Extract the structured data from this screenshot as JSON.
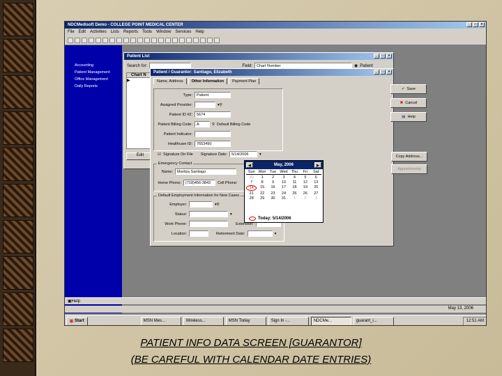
{
  "app": {
    "title": "NDCMedisoft Demo - COLLEGE POINT MEDICAL CENTER",
    "menu": [
      "File",
      "Edit",
      "Activities",
      "Lists",
      "Reports",
      "Tools",
      "Window",
      "Services",
      "Help"
    ]
  },
  "nav": {
    "items": [
      "Accounting",
      "Patient Management",
      "Office Management",
      "Daily Reports"
    ]
  },
  "patient_list": {
    "title": "Patient List",
    "search_label": "Search for:",
    "field_label": "Field:",
    "field_value": "Chart Number",
    "radio_label": "Patient",
    "col_header": "Chart N",
    "edit_label": "Edit"
  },
  "guarantor": {
    "title": "Patient / Guarantor: Santiago, Elizabeth",
    "tabs": [
      "Name, Address",
      "Other Information",
      "Payment Plan"
    ],
    "type_label": "Type:",
    "type_value": "Patient",
    "assigned_provider_label": "Assigned Provider:",
    "patient_id2_label": "Patient ID #2:",
    "patient_id2_value": "5674",
    "billing_code_label": "Patient Billing Code:",
    "billing_code_value": "A",
    "billing_code_note": "Default Billing Code",
    "indicator_label": "Patient Indicator:",
    "healthcare_id_label": "Healthcare ID:",
    "healthcare_id_value": "7653490",
    "signature_label": "Signature On File",
    "signature_date_label": "Signature Date:",
    "signature_date_value": "5/14/2006",
    "emergency_title": "Emergency Contact",
    "name_label": "Name:",
    "name_value": "Maritza Santiago",
    "home_phone_label": "Home Phone:",
    "home_phone_value": "(718)456-3843",
    "cell_phone_label": "Cell Phone:",
    "employment_title": "Default Employment Information for New Cases",
    "employer_label": "Employer:",
    "status_label": "Status:",
    "work_phone_label": "Work Phone:",
    "extension_label": "Extension:",
    "location_label": "Location:",
    "retirement_label": "Retirement Date:"
  },
  "side_buttons": [
    "Save",
    "Cancel",
    "Help",
    "Copy Address...",
    "Appointments"
  ],
  "calendar": {
    "month": "May, 2006",
    "dows": [
      "Sun",
      "Mon",
      "Tue",
      "Wed",
      "Thu",
      "Fri",
      "Sat"
    ],
    "weeks": [
      [
        "30",
        "1",
        "2",
        "3",
        "4",
        "5",
        "6"
      ],
      [
        "7",
        "8",
        "9",
        "10",
        "11",
        "12",
        "13"
      ],
      [
        "14",
        "15",
        "16",
        "17",
        "18",
        "19",
        "20"
      ],
      [
        "21",
        "22",
        "23",
        "24",
        "25",
        "26",
        "27"
      ],
      [
        "28",
        "29",
        "30",
        "31",
        "1",
        "2",
        "3"
      ]
    ],
    "today": "Today: 5/14/2006",
    "selected": "14"
  },
  "status": {
    "help": "Help",
    "date": "May 13, 2006"
  },
  "taskbar": {
    "start": "Start",
    "tasks": [
      "MSN Mes...",
      "Wireless...",
      "MSN Today",
      "Sign In -...",
      "NDCMe...",
      "guarant_i..."
    ],
    "clock": "12:51 AM"
  },
  "caption": {
    "line1": "PATIENT INFO DATA SCREEN [GUARANTOR]",
    "line2": "(BE CAREFUL WITH CALENDAR DATE ENTRIES)"
  }
}
